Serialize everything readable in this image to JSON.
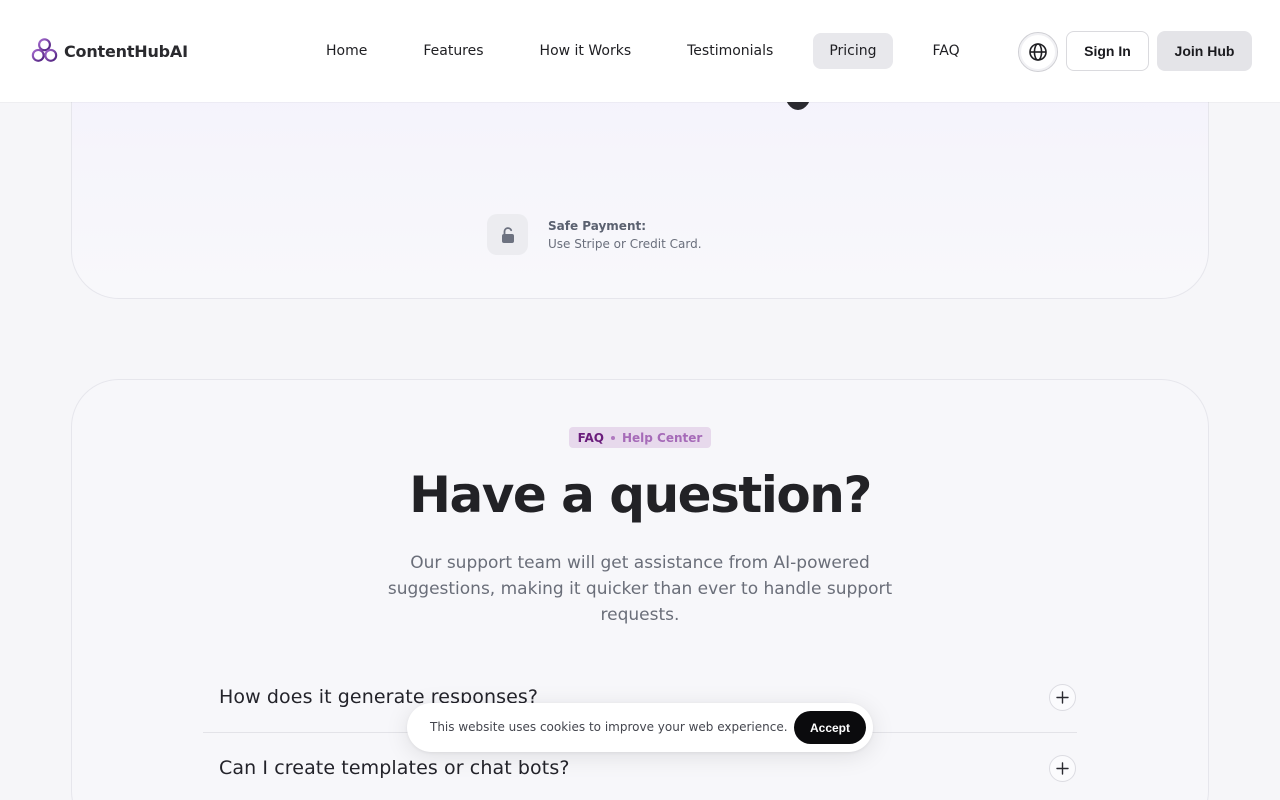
{
  "header": {
    "brand_name": "ContentHubAI",
    "nav": [
      {
        "label": "Home"
      },
      {
        "label": "Features"
      },
      {
        "label": "How it Works"
      },
      {
        "label": "Testimonials"
      },
      {
        "label": "Pricing",
        "active": true
      },
      {
        "label": "FAQ"
      }
    ],
    "sign_in_label": "Sign In",
    "join_label": "Join Hub"
  },
  "payment": {
    "title": "Safe Payment:",
    "subtitle": "Use Stripe or Credit Card."
  },
  "faq": {
    "badge_main": "FAQ",
    "badge_sub": "Help Center",
    "title": "Have a question?",
    "description": "Our support team will get assistance from AI-powered suggestions, making it quicker than ever to handle support requests.",
    "items": [
      {
        "question": "How does it generate responses?"
      },
      {
        "question": "Can I create templates or chat bots?"
      }
    ]
  },
  "cookie": {
    "message": "This website uses cookies to improve your web experience.",
    "accept_label": "Accept"
  },
  "colors": {
    "brand_purple": "#7b3fa0",
    "badge_bg": "#e7d9ec",
    "accept_bg": "#0b0b0d",
    "page_bg": "#f6f6f9"
  },
  "icons": [
    "hexagon-logo-icon",
    "globe-icon",
    "lock-icon",
    "plus-icon"
  ]
}
